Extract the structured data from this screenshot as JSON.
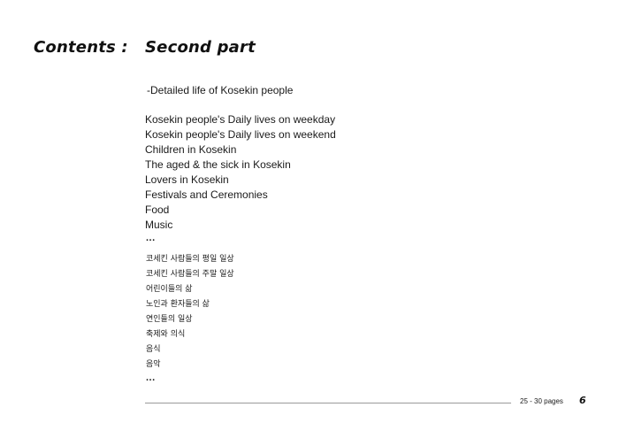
{
  "header": {
    "contents_label": "Contents :",
    "section_title": "Second part"
  },
  "subtitle": "-Detailed life of Kosekin people",
  "english_items": [
    "Kosekin people's Daily lives on weekday",
    "Kosekin people's Daily lives on weekend",
    "Children in Kosekin",
    "The aged & the sick in Kosekin",
    "Lovers in Kosekin",
    "Festivals and Ceremonies",
    "Food",
    "Music"
  ],
  "english_ellipsis": "...",
  "korean_items": [
    "코세킨 사람들의 평일 일상",
    "코세킨 사람들의 주말 일상",
    "어린이들의 삶",
    "노인과 환자들의 삶",
    "연인들의 일상",
    "축제와 의식",
    "음식",
    "음악"
  ],
  "korean_ellipsis": "...",
  "footer": {
    "page_range": "25 - 30 pages",
    "page_number": "6"
  }
}
